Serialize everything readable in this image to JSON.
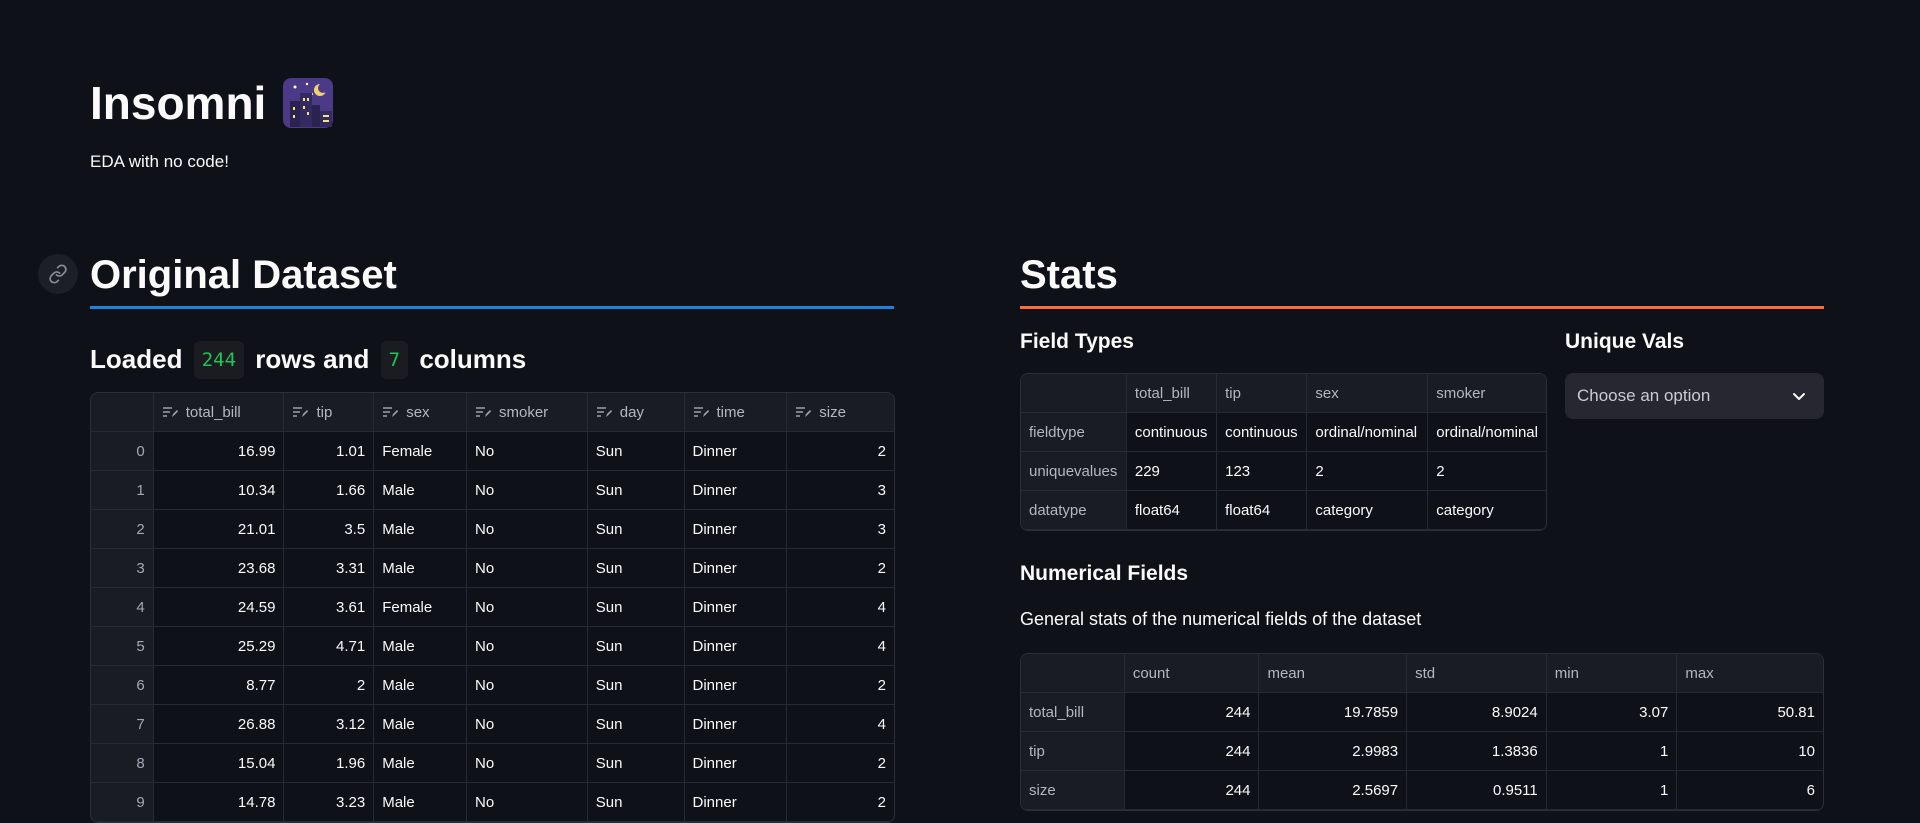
{
  "header": {
    "title": "Insomni",
    "subtitle": "EDA with no code!"
  },
  "left": {
    "section_title": "Original Dataset",
    "loaded": {
      "prefix": "Loaded",
      "rows": "244",
      "middle": "rows and",
      "cols": "7",
      "suffix": "columns"
    },
    "table": {
      "columns": [
        "total_bill",
        "tip",
        "sex",
        "smoker",
        "day",
        "time",
        "size"
      ],
      "rows": [
        [
          "0",
          "16.99",
          "1.01",
          "Female",
          "No",
          "Sun",
          "Dinner",
          "2"
        ],
        [
          "1",
          "10.34",
          "1.66",
          "Male",
          "No",
          "Sun",
          "Dinner",
          "3"
        ],
        [
          "2",
          "21.01",
          "3.5",
          "Male",
          "No",
          "Sun",
          "Dinner",
          "3"
        ],
        [
          "3",
          "23.68",
          "3.31",
          "Male",
          "No",
          "Sun",
          "Dinner",
          "2"
        ],
        [
          "4",
          "24.59",
          "3.61",
          "Female",
          "No",
          "Sun",
          "Dinner",
          "4"
        ],
        [
          "5",
          "25.29",
          "4.71",
          "Male",
          "No",
          "Sun",
          "Dinner",
          "4"
        ],
        [
          "6",
          "8.77",
          "2",
          "Male",
          "No",
          "Sun",
          "Dinner",
          "2"
        ],
        [
          "7",
          "26.88",
          "3.12",
          "Male",
          "No",
          "Sun",
          "Dinner",
          "4"
        ],
        [
          "8",
          "15.04",
          "1.96",
          "Male",
          "No",
          "Sun",
          "Dinner",
          "2"
        ],
        [
          "9",
          "14.78",
          "3.23",
          "Male",
          "No",
          "Sun",
          "Dinner",
          "2"
        ]
      ]
    }
  },
  "right": {
    "section_title": "Stats",
    "field_types": {
      "title": "Field Types",
      "columns": [
        "total_bill",
        "tip",
        "sex",
        "smoker"
      ],
      "rows": [
        [
          "fieldtype",
          "continuous",
          "continuous",
          "ordinal/nominal",
          "ordinal/nominal"
        ],
        [
          "uniquevalues",
          "229",
          "123",
          "2",
          "2"
        ],
        [
          "datatype",
          "float64",
          "float64",
          "category",
          "category"
        ]
      ]
    },
    "unique_vals": {
      "title": "Unique Vals",
      "placeholder": "Choose an option"
    },
    "numerical": {
      "title": "Numerical Fields",
      "description": "General stats of the numerical fields of the dataset",
      "columns": [
        "count",
        "mean",
        "std",
        "min",
        "max"
      ],
      "rows": [
        [
          "total_bill",
          "244",
          "19.7859",
          "8.9024",
          "3.07",
          "50.81"
        ],
        [
          "tip",
          "244",
          "2.9983",
          "1.3836",
          "1",
          "10"
        ],
        [
          "size",
          "244",
          "2.5697",
          "0.9511",
          "1",
          "6"
        ]
      ]
    }
  },
  "colors": {
    "left_rule": "#1c83e1",
    "right_rule": "#ff6c37",
    "code_green": "#21c354",
    "background": "#0e1117"
  },
  "icons": {
    "title": "night-city-icon",
    "anchor": "link-icon",
    "column": "edit-column-icon",
    "dropdown": "chevron-down-icon"
  }
}
